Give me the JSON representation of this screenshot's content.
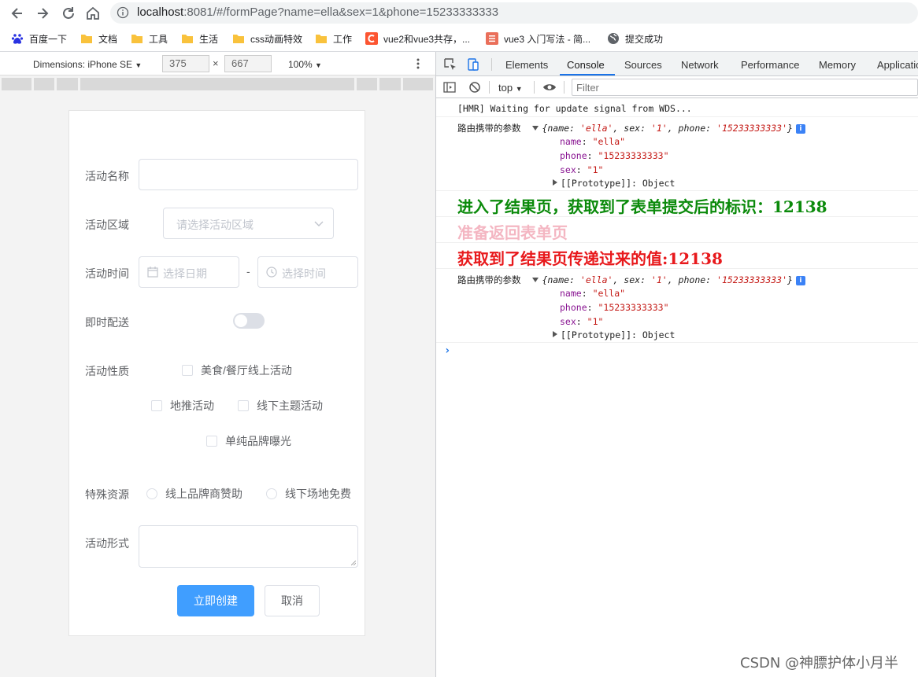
{
  "browser": {
    "url_host": "localhost",
    "url_rest": ":8081/#/formPage?name=ella&sex=1&phone=15233333333",
    "bookmarks": [
      {
        "label": "百度一下",
        "icon": "baidu-paw-icon"
      },
      {
        "label": "文档",
        "icon": "folder-icon"
      },
      {
        "label": "工具",
        "icon": "folder-icon"
      },
      {
        "label": "生活",
        "icon": "folder-icon"
      },
      {
        "label": "css动画特效",
        "icon": "folder-icon"
      },
      {
        "label": "工作",
        "icon": "folder-icon"
      },
      {
        "label": "vue2和vue3共存，...",
        "icon": "csdn-icon"
      },
      {
        "label": "vue3 入门写法 - 简...",
        "icon": "jianshu-icon"
      },
      {
        "label": "提交成功",
        "icon": "globe-icon"
      }
    ]
  },
  "device_toolbar": {
    "dimensions_label": "Dimensions: iPhone SE",
    "width": "375",
    "height": "667",
    "times": "×",
    "zoom": "100%"
  },
  "form": {
    "name_label": "活动名称",
    "region_label": "活动区域",
    "region_placeholder": "请选择活动区域",
    "time_label": "活动时间",
    "date_placeholder": "选择日期",
    "dash": "-",
    "time_placeholder": "选择时间",
    "delivery_label": "即时配送",
    "delivery_on": false,
    "nature_label": "活动性质",
    "nature_options": [
      "美食/餐厅线上活动",
      "地推活动",
      "线下主题活动",
      "单纯品牌曝光"
    ],
    "resource_label": "特殊资源",
    "resource_options": [
      "线上品牌商赞助",
      "线下场地免费"
    ],
    "form_label": "活动形式",
    "submit": "立即创建",
    "cancel": "取消"
  },
  "devtools": {
    "tabs": [
      "Elements",
      "Console",
      "Sources",
      "Network",
      "Performance",
      "Memory",
      "Applicatio"
    ],
    "active_tab": "Console",
    "context": "top",
    "filter_placeholder": "Filter"
  },
  "console": {
    "hmr": "[HMR] Waiting for update signal from WDS...",
    "route_label": "路由携带的参数",
    "obj_summary_open": "{name: ",
    "obj_name_val": "'ella'",
    "obj_sep1": ", sex: ",
    "obj_sex_val": "'1'",
    "obj_sep2": ", phone: ",
    "obj_phone_val": "'15233333333'",
    "obj_summary_close": "}",
    "info_badge": "i",
    "prop_name_key": "name",
    "prop_name_val": "\"ella\"",
    "prop_phone_key": "phone",
    "prop_phone_val": "\"15233333333\"",
    "prop_sex_key": "sex",
    "prop_sex_val": "\"1\"",
    "prop_proto": "[[Prototype]]",
    "prop_proto_val": ": Object",
    "colon": ": ",
    "styled_msgs": [
      {
        "text": "进入了结果页，获取到了表单提交后的标识：12138",
        "color": "#0b8a0b"
      },
      {
        "text": "准备返回表单页",
        "color": "#f4b6c2"
      },
      {
        "text": "获取到了结果页传递过来的值:12138",
        "color": "#e8191c"
      }
    ],
    "prompt": "›"
  },
  "watermark": "CSDN @神膘护体小月半"
}
